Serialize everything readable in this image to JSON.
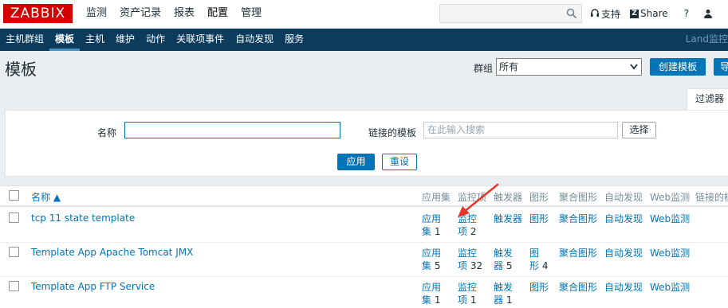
{
  "logo": "ZABBIX",
  "topnav": [
    "监测",
    "资产记录",
    "报表",
    "配置",
    "管理"
  ],
  "topnav_active": 3,
  "search": {
    "placeholder": ""
  },
  "toplinks": {
    "support": "支持",
    "share": "Share",
    "help": "?",
    "user": "👤"
  },
  "subnav": [
    "主机群组",
    "模板",
    "主机",
    "维护",
    "动作",
    "关联项事件",
    "自动发现",
    "服务"
  ],
  "subnav_active": 1,
  "subnav_right": "Land监控",
  "page": {
    "title": "模板",
    "group_label": "群组",
    "group_value": "所有",
    "create_button": "创建模板",
    "import_button": "导"
  },
  "filter": {
    "tab": "过滤器",
    "name_label": "名称",
    "name_value": "",
    "linked_label": "链接的模板",
    "linked_placeholder": "在此输入搜索",
    "select_button": "选择",
    "apply_button": "应用",
    "reset_button": "重设"
  },
  "table": {
    "headers": {
      "name": "名称 ▲",
      "apps": "应用集",
      "items": "监控项",
      "triggers": "触发器",
      "graphs": "图形",
      "screens": "聚合图形",
      "discovery": "自动发现",
      "web": "Web监测",
      "linked": "链接的模"
    },
    "rows": [
      {
        "name": "tcp 11 state template",
        "apps_l1": "应用",
        "apps_l2": "集",
        "apps_count": "1",
        "items_l1": "监控",
        "items_l2": "项",
        "items_count": "2",
        "triggers_l1": "触发器",
        "triggers_l2": "",
        "triggers_count": "",
        "graphs_l1": "图形",
        "graphs_l2": "",
        "graphs_count": "",
        "screens": "聚合图形",
        "discovery": "自动发现",
        "web": "Web监测"
      },
      {
        "name": "Template App Apache Tomcat JMX",
        "apps_l1": "应用",
        "apps_l2": "集",
        "apps_count": "5",
        "items_l1": "监控",
        "items_l2": "项",
        "items_count": "32",
        "triggers_l1": "触发",
        "triggers_l2": "器",
        "triggers_count": "5",
        "graphs_l1": "图",
        "graphs_l2": "形",
        "graphs_count": "4",
        "screens": "聚合图形",
        "discovery": "自动发现",
        "web": "Web监测"
      },
      {
        "name": "Template App FTP Service",
        "apps_l1": "应用",
        "apps_l2": "集",
        "apps_count": "1",
        "items_l1": "监控",
        "items_l2": "项",
        "items_count": "1",
        "triggers_l1": "触发",
        "triggers_l2": "器",
        "triggers_count": "1",
        "graphs_l1": "图形",
        "graphs_l2": "",
        "graphs_count": "",
        "screens": "聚合图形",
        "discovery": "自动发现",
        "web": "Web监测"
      }
    ]
  },
  "colors": {
    "brand": "#d40000",
    "nav": "#0c3b5b",
    "link": "#0275b8",
    "arrow": "#e8352a"
  }
}
